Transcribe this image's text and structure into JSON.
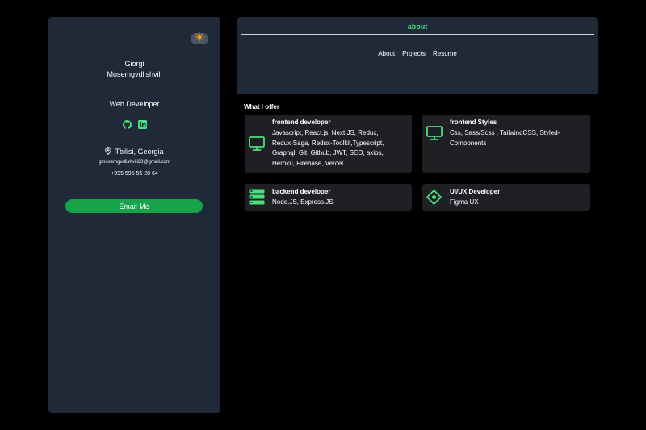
{
  "sidebar": {
    "name_line1": "Giorgi",
    "name_line2": "Mosemgvdlishvili",
    "role": "Web Developer",
    "location": "Tbilisi, Georgia",
    "email": "gmosemgvdlishvili28@gmail.com",
    "phone": "+995 595 55 28 64",
    "email_button": "Email Me",
    "social_icons": [
      "github-icon",
      "linkedin-icon"
    ]
  },
  "header": {
    "title": "about",
    "nav": [
      "About",
      "Projects",
      "Resume"
    ]
  },
  "offer": {
    "heading": "What i offer",
    "cards": [
      {
        "icon": "monitor-icon",
        "title": "frontend developer",
        "desc_lines": [
          "Javascript, React.js, Next.JS, Redux,",
          "Redux-Saga, Redux-Toolkit,Typescript,",
          "Graphql, Git, Github, JWT, SEO, axios,",
          "Heroku, Firebase, Vercel"
        ]
      },
      {
        "icon": "monitor-icon",
        "title": "frontend Styles",
        "desc_lines": [
          "Css, Sass/Scss , TailwindCSS, Styled-",
          "Components"
        ]
      },
      {
        "icon": "server-icon",
        "title": "backend developer",
        "desc_lines": [
          "Node.JS, Express.JS"
        ]
      },
      {
        "icon": "figma-diamond-icon",
        "title": "UI/UX Developer",
        "desc_lines": [
          "Figma UX"
        ]
      }
    ]
  },
  "colors": {
    "accent": "#4ade80",
    "button": "#16a34a",
    "panel": "#1f2937",
    "card": "#1f2023",
    "background": "#000000"
  }
}
